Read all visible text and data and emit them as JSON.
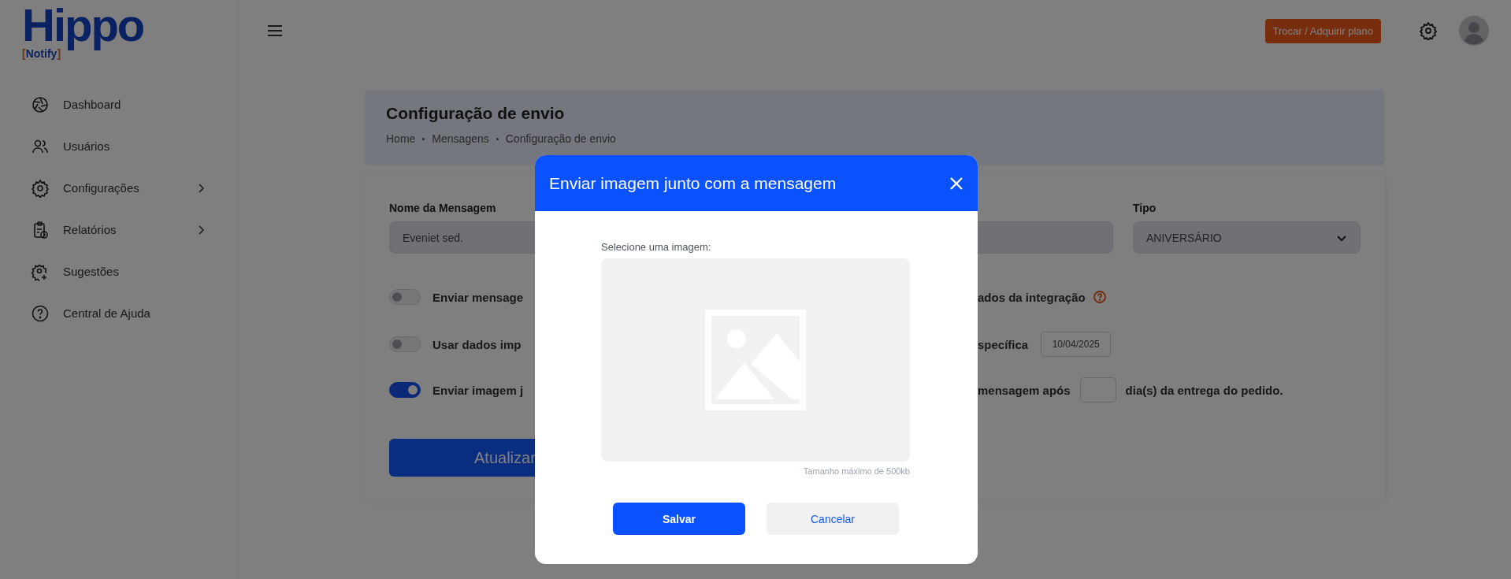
{
  "brand": {
    "name": "Hippo",
    "tag": "[Notify]"
  },
  "sidebar": {
    "items": [
      {
        "label": "Dashboard",
        "submenu": false
      },
      {
        "label": "Usuários",
        "submenu": false
      },
      {
        "label": "Configurações",
        "submenu": true
      },
      {
        "label": "Relatórios",
        "submenu": true
      },
      {
        "label": "Sugestões",
        "submenu": false
      },
      {
        "label": "Central de Ajuda",
        "submenu": false
      }
    ]
  },
  "header": {
    "plan_button": "Trocar / Adquirir plano"
  },
  "page": {
    "title": "Configuração de envio",
    "breadcrumb": [
      "Home",
      "Mensagens",
      "Configuração de envio"
    ]
  },
  "form": {
    "name_field": {
      "label": "Nome da Mensagem",
      "value": "Eveniet sed."
    },
    "type_field": {
      "label": "Tipo",
      "value": "ANIVERSÁRIO"
    },
    "rows": [
      {
        "label": "Enviar mensage",
        "on": false,
        "kind": "help",
        "right_label": "ados da integração"
      },
      {
        "label": "Usar dados imp",
        "on": false,
        "kind": "date",
        "right_label": "specífica",
        "value": "10/04/2025"
      },
      {
        "label": "Enviar imagem j",
        "on": true,
        "kind": "days",
        "right_label": "mensagem após",
        "suffix": "dia(s) da entrega do pedido."
      }
    ],
    "submit": "Atualizar"
  },
  "modal": {
    "title": "Enviar imagem junto com a mensagem",
    "field_label": "Selecione uma imagem:",
    "hint": "Tamanho máximo de 500kb",
    "buttons": [
      {
        "label": "Salvar",
        "kind": "primary"
      },
      {
        "label": "Cancelar",
        "kind": "secondary"
      }
    ]
  }
}
